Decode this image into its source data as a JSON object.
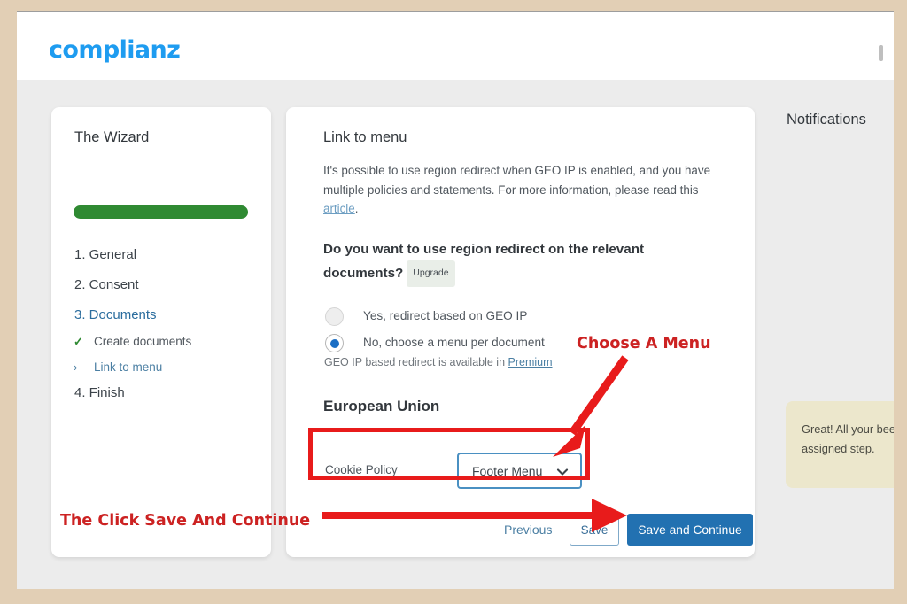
{
  "brand": {
    "logo_text": "complianz"
  },
  "wizard": {
    "title": "The Wizard",
    "progress_percent": 100,
    "progress_color": "#2f8a32",
    "steps": [
      {
        "label": "1. General",
        "active": false
      },
      {
        "label": "2. Consent",
        "active": false
      },
      {
        "label": "3. Documents",
        "active": true
      },
      {
        "label": "4. Finish",
        "active": false
      }
    ],
    "substeps": [
      {
        "mark": "✓",
        "label": "Create documents",
        "state": "done"
      },
      {
        "mark": "›",
        "label": "Link to menu",
        "state": "current"
      }
    ]
  },
  "main": {
    "title": "Link to menu",
    "intro_before_link": "It's possible to use region redirect when GEO IP is enabled, and you have multiple policies and statements. For more information, please read this ",
    "intro_link": "article",
    "intro_after_link": ".",
    "question": "Do you want to use region redirect on the relevant documents?",
    "upgrade_badge": "Upgrade",
    "radios": [
      {
        "label": "Yes, redirect based on GEO IP",
        "checked": false
      },
      {
        "label": "No, choose a menu per document",
        "checked": true
      }
    ],
    "premium_note_before": "GEO IP based redirect is available in ",
    "premium_note_link": "Premium",
    "region_title": "European Union",
    "menu_row": {
      "label": "Cookie Policy",
      "selected_value": "Footer Menu"
    },
    "buttons": {
      "previous": "Previous",
      "save": "Save",
      "save_and_continue": "Save and Continue"
    }
  },
  "notifications": {
    "title": "Notifications",
    "items": [
      {
        "text": "Great! All your  been assigned  step.",
        "background": "#ece7cc"
      }
    ]
  },
  "annotations": {
    "choose_menu": "Choose A Menu",
    "click_save": "The Click Save And Continue",
    "color": "#cc2222",
    "box_color": "#e81b1b"
  },
  "colors": {
    "frame": "#e2cfb5",
    "page_background": "#ececec",
    "accent_blue": "#2271b1",
    "brand_blue": "#1e9cf0",
    "select_border": "#4a90c2"
  }
}
